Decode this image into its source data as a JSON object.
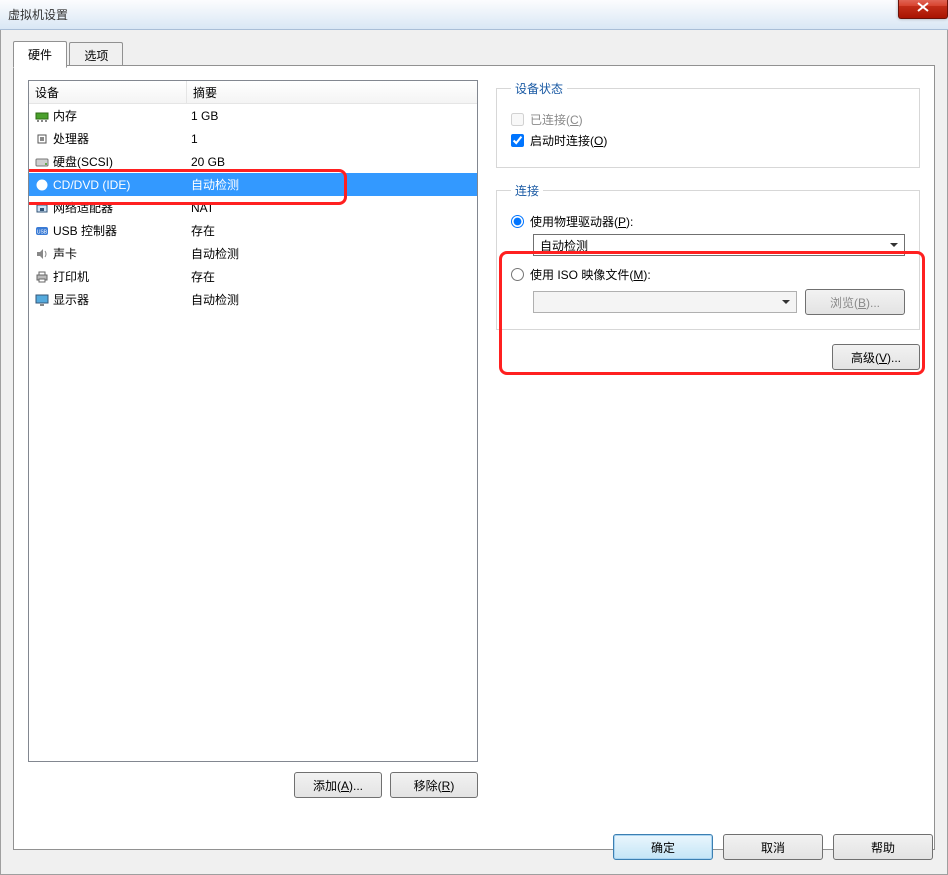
{
  "window": {
    "title": "虚拟机设置"
  },
  "tabs": {
    "hardware": "硬件",
    "options": "选项"
  },
  "list": {
    "header_device": "设备",
    "header_summary": "摘要",
    "rows": [
      {
        "name": "内存",
        "summary": "1 GB"
      },
      {
        "name": "处理器",
        "summary": "1"
      },
      {
        "name": "硬盘(SCSI)",
        "summary": "20 GB"
      },
      {
        "name": "CD/DVD (IDE)",
        "summary": "自动检测"
      },
      {
        "name": "网络适配器",
        "summary": "NAT"
      },
      {
        "name": "USB 控制器",
        "summary": "存在"
      },
      {
        "name": "声卡",
        "summary": "自动检测"
      },
      {
        "name": "打印机",
        "summary": "存在"
      },
      {
        "name": "显示器",
        "summary": "自动检测"
      }
    ]
  },
  "buttons": {
    "add": "添加(A)...",
    "remove": "移除(R)",
    "browse": "浏览(B)...",
    "advanced": "高级(V)...",
    "ok": "确定",
    "cancel": "取消",
    "help": "帮助"
  },
  "status_group": {
    "legend": "设备状态",
    "connected": "已连接(C)",
    "connect_at_power_on": "启动时连接(O)"
  },
  "connection_group": {
    "legend": "连接",
    "use_physical": "使用物理驱动器(P):",
    "physical_selected": "自动检测",
    "use_iso": "使用 ISO 映像文件(M):",
    "iso_path": ""
  },
  "colors": {
    "accent_select": "#3399ff",
    "annot": "#ff2020"
  }
}
